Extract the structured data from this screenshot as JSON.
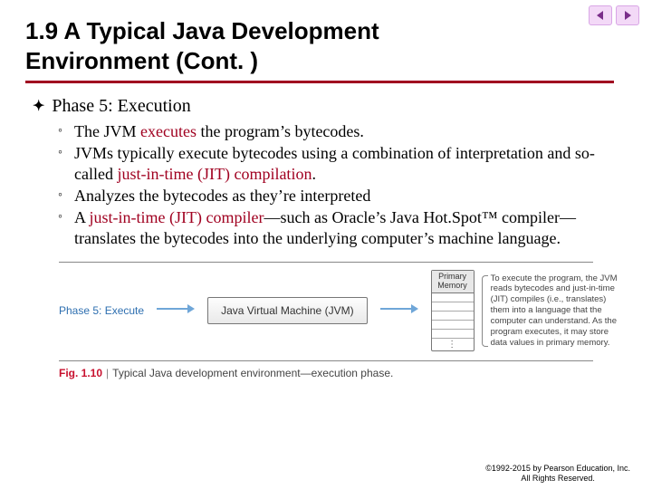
{
  "nav": {
    "prev": "prev",
    "next": "next"
  },
  "title": "1.9  A Typical Java Development Environment (Cont. )",
  "phase_heading": "Phase 5: Execution",
  "bullets": [
    {
      "pre": "The JVM ",
      "kw": "executes",
      "post": " the program’s bytecodes."
    },
    {
      "pre": "JVMs typically execute bytecodes using a combination of interpretation and so-called ",
      "kw": "just-in-time (JIT) compilation",
      "post": "."
    },
    {
      "pre": "Analyzes the bytecodes as they’re interpreted",
      "kw": "",
      "post": ""
    },
    {
      "pre": "A ",
      "kw": "just-in-time (JIT) compiler",
      "post": "—such as Oracle’s Java Hot.Spot™ compiler—translates the bytecodes into the underlying computer’s machine language."
    }
  ],
  "figure": {
    "phase_label": "Phase 5: Execute",
    "jvm_box": "Java Virtual Machine (JVM)",
    "memory_header": "Primary Memory",
    "annotation": "To execute the program, the JVM reads bytecodes and just-in-time (JIT) compiles (i.e., translates) them into a language that the computer can understand. As the program executes, it may store data values in primary memory.",
    "fignum": "Fig. 1.10",
    "caption": "Typical Java development environment—execution phase."
  },
  "copyright_line1": "©1992-2015 by Pearson Education, Inc.",
  "copyright_line2": "All Rights Reserved."
}
